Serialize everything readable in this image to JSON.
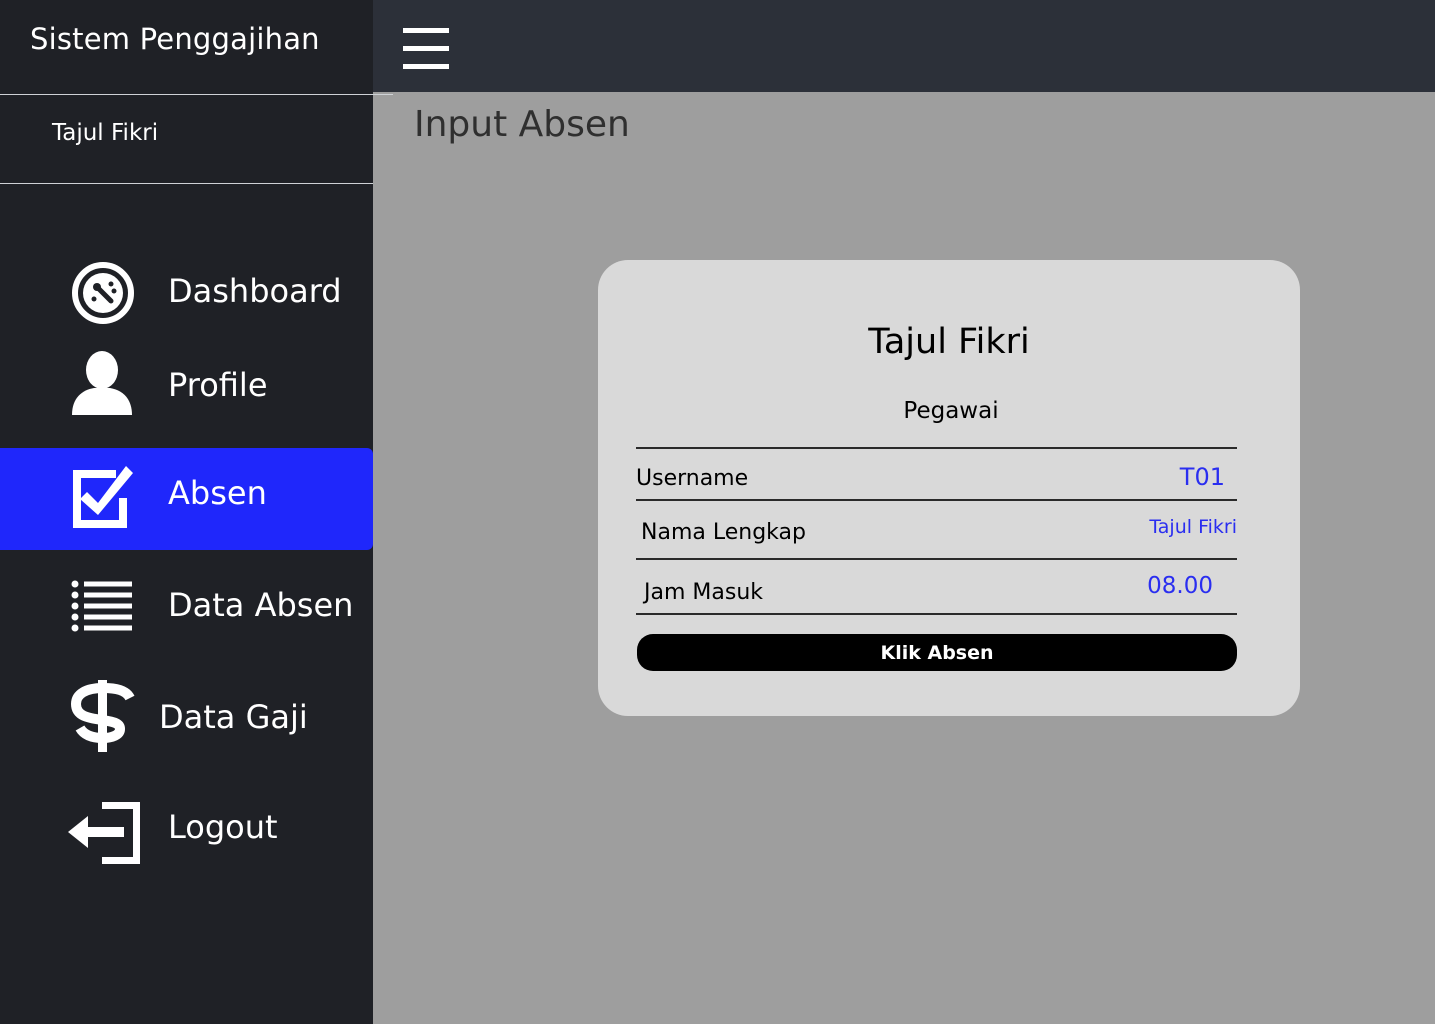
{
  "app": {
    "title": "Sistem Penggajihan"
  },
  "sidebar": {
    "user_name": "Tajul Fikri",
    "items": [
      {
        "label": "Dashboard",
        "icon": "dashboard-icon"
      },
      {
        "label": "Profile",
        "icon": "user-icon"
      },
      {
        "label": "Absen",
        "icon": "checkbox-icon",
        "active": true
      },
      {
        "label": "Data Absen",
        "icon": "list-icon"
      },
      {
        "label": "Data Gaji",
        "icon": "dollar-icon"
      },
      {
        "label": "Logout",
        "icon": "logout-icon"
      }
    ]
  },
  "topbar": {
    "menu_icon": "hamburger-icon"
  },
  "page": {
    "title": "Input Absen"
  },
  "card": {
    "name": "Tajul Fikri",
    "role": "Pegawai",
    "rows": [
      {
        "label": "Username",
        "value": "T01"
      },
      {
        "label": "Nama Lengkap",
        "value": "Tajul Fikri"
      },
      {
        "label": "Jam Masuk",
        "value": "08.00"
      }
    ],
    "button_label": "Klik Absen"
  },
  "colors": {
    "sidebar_bg": "#1f2126",
    "topbar_bg": "#2c3039",
    "content_bg": "#9e9e9e",
    "active_item": "#1f27fb",
    "card_bg": "#d9d9d9",
    "value_text": "#2a2ef0",
    "button_bg": "#000000"
  }
}
